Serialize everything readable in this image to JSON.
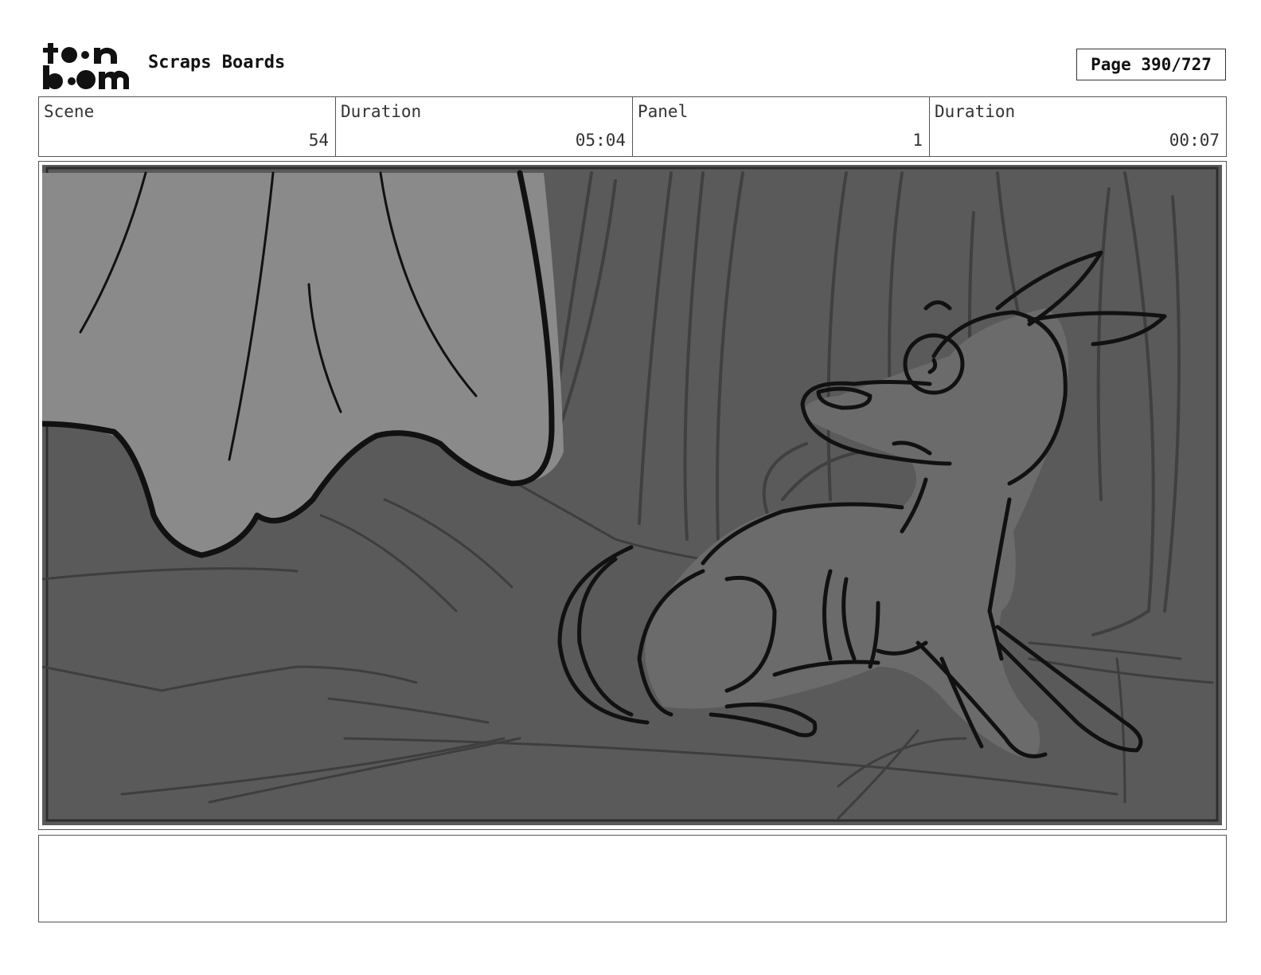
{
  "header": {
    "project_title": "Scraps Boards",
    "page_label": "Page 390/727"
  },
  "info": [
    {
      "label": "Scene",
      "value": "54"
    },
    {
      "label": "Duration",
      "value": "05:04"
    },
    {
      "label": "Panel",
      "value": "1"
    },
    {
      "label": "Duration",
      "value": "00:07"
    }
  ],
  "panel": {
    "description": "",
    "colors": {
      "background": "#5a5a5a",
      "drape": "#8a8a8a",
      "ink": "#111111",
      "dog": "#6b6b6b"
    }
  },
  "notes": {
    "text": ""
  }
}
